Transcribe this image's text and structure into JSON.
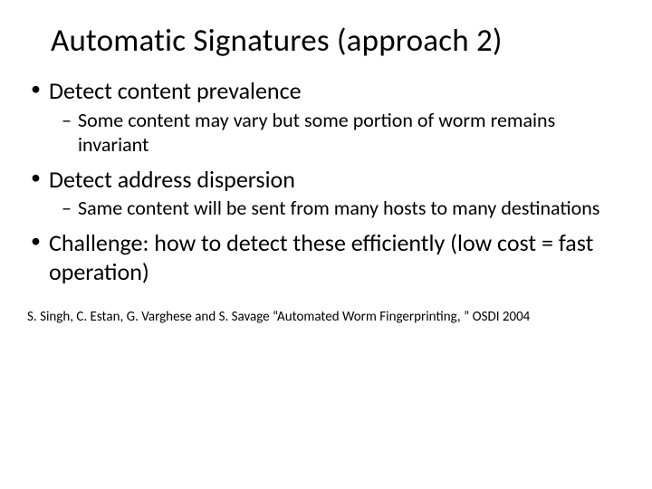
{
  "title": "Automatic Signatures (approach 2)",
  "bullets": [
    {
      "text": "Detect content prevalence",
      "sub": [
        "Some content may vary but some portion of worm remains invariant"
      ]
    },
    {
      "text": "Detect address dispersion",
      "sub": [
        "Same content will be sent from many hosts to many destinations"
      ]
    },
    {
      "text": "Challenge: how to detect these efficiently (low cost = fast operation)",
      "sub": []
    }
  ],
  "citation": "S. Singh, C. Estan, G. Varghese and S. Savage “Automated Worm Fingerprinting, ” OSDI 2004"
}
